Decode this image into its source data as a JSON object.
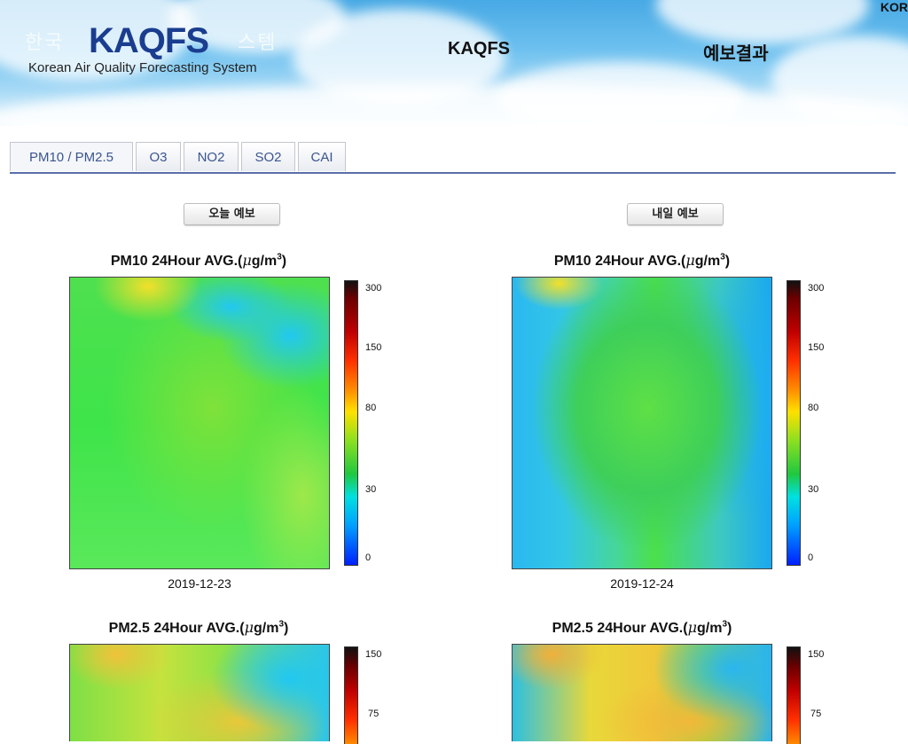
{
  "header": {
    "logo_ghost_left": "한국",
    "logo_ghost_right": "스템",
    "logo": "KAQFS",
    "logo_subtitle": "Korean Air Quality Forecasting System",
    "nav": [
      "KAQFS",
      "예보결과"
    ],
    "language": "KOR"
  },
  "tabs": [
    "PM10 / PM2.5",
    "O3",
    "NO2",
    "SO2",
    "CAI"
  ],
  "columns": [
    {
      "button": "오늘 예보",
      "pm10": {
        "title_prefix": "PM10 24Hour AVG.(",
        "mu": "μ",
        "unit": "g/m",
        "sup": "3",
        "close": ")",
        "date": "2019-12-23",
        "ticks": [
          "300",
          "150",
          "80",
          "30",
          "0"
        ]
      },
      "pm25": {
        "title_prefix": "PM2.5 24Hour AVG.(",
        "mu": "μ",
        "unit": "g/m",
        "sup": "3",
        "close": ")",
        "ticks": [
          "150",
          "75"
        ]
      }
    },
    {
      "button": "내일 예보",
      "pm10": {
        "title_prefix": "PM10 24Hour AVG.(",
        "mu": "μ",
        "unit": "g/m",
        "sup": "3",
        "close": ")",
        "date": "2019-12-24",
        "ticks": [
          "300",
          "150",
          "80",
          "30",
          "0"
        ]
      },
      "pm25": {
        "title_prefix": "PM2.5 24Hour AVG.(",
        "mu": "μ",
        "unit": "g/m",
        "sup": "3",
        "close": ")",
        "ticks": [
          "150",
          "75"
        ]
      }
    }
  ],
  "colors": {
    "header_sky": "#48a9e4",
    "logo": "#1a3d8f",
    "tab_text": "#3a5590",
    "tab_rule": "#5a6ea8",
    "map_green": "#3ee44a",
    "map_cyan": "#22c8f0",
    "map_yellow": "#f2e02a"
  }
}
